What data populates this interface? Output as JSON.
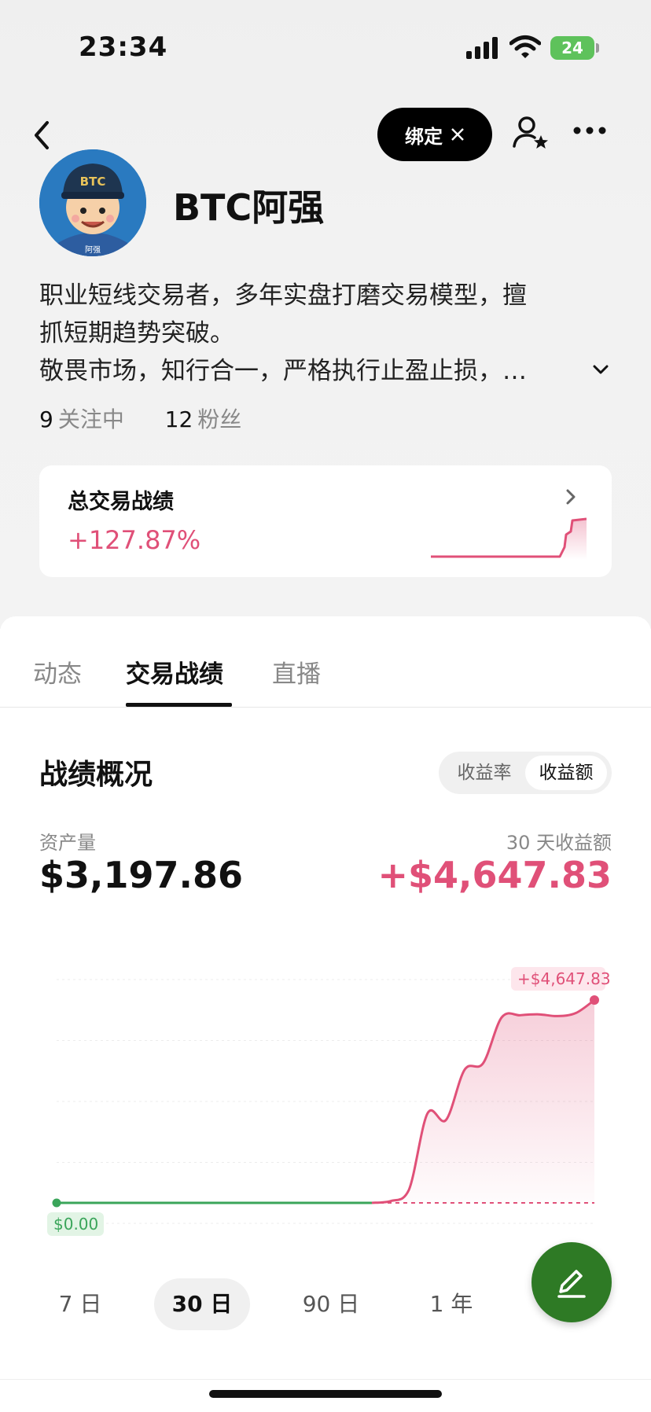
{
  "status_bar": {
    "time": "23:34",
    "battery": "24"
  },
  "header": {
    "bind_label": "绑定",
    "bind_icon": "x-logo-icon"
  },
  "profile": {
    "avatar_text": "BTC",
    "avatar_caption": "阿强",
    "name": "BTC阿强",
    "bio_lines": [
      "职业短线交易者，多年实盘打磨交易模型，擅",
      "抓短期趋势突破。",
      "敬畏市场，知行合一，严格执行止盈止损，…"
    ],
    "following_count": "9",
    "following_label": "关注中",
    "followers_count": "12",
    "followers_label": "粉丝"
  },
  "performance_card": {
    "title": "总交易战绩",
    "percent": "+127.87%"
  },
  "tabs": [
    {
      "label": "动态",
      "active": false
    },
    {
      "label": "交易战绩",
      "active": true
    },
    {
      "label": "直播",
      "active": false
    }
  ],
  "overview": {
    "title": "战绩概况",
    "toggle": [
      {
        "label": "收益率",
        "active": false
      },
      {
        "label": "收益额",
        "active": true
      }
    ],
    "asset_label": "资产量",
    "asset_value": "$3,197.86",
    "profit_label": "30 天收益额",
    "profit_value": "+$4,647.83"
  },
  "chart_data": {
    "type": "area",
    "start_label": "$0.00",
    "end_label": "+$4,647.83",
    "baseline": 0,
    "colors": {
      "positive": "#e05078",
      "baseline": "#3aa55a"
    },
    "x": [
      1,
      2,
      3,
      4,
      5,
      6,
      7,
      8,
      9,
      10,
      11,
      12,
      13,
      14,
      15,
      16,
      17,
      18,
      19,
      20,
      21,
      22,
      23,
      24,
      25,
      26,
      27,
      28,
      29,
      30
    ],
    "values": [
      0,
      0,
      0,
      0,
      0,
      0,
      0,
      0,
      0,
      0,
      0,
      0,
      0,
      0,
      0,
      0,
      0,
      0,
      40,
      300,
      2050,
      1900,
      3050,
      3200,
      4250,
      4300,
      4320,
      4280,
      4350,
      4647.83
    ]
  },
  "range_tabs": [
    {
      "label": "7 日",
      "active": false
    },
    {
      "label": "30 日",
      "active": true
    },
    {
      "label": "90 日",
      "active": false
    },
    {
      "label": "1 年",
      "active": false
    }
  ],
  "fab": {
    "icon": "edit-pen-icon"
  }
}
